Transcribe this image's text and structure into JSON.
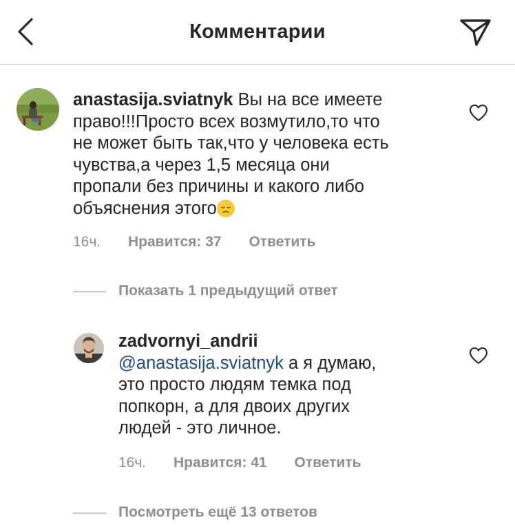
{
  "header": {
    "title": "Комментарии"
  },
  "comments": [
    {
      "username": "anastasija.sviatnyk",
      "text": " Вы на все имеете право!!!Просто всех возмутило,то что не может быть так,что у человека есть чувства,а через 1,5 месяца они пропали без причины и какого либо объяснения этого",
      "lines": [
        "Вы на все имеете",
        "право!!!Просто всех возмутило,то что",
        "не может быть так,что у человека есть",
        "чувства,а через 1,5 месяца они",
        "пропали без причины и какого либо",
        "объяснения этого"
      ],
      "emoji": "disappointed-face-emoji",
      "time": "16ч.",
      "likes": "Нравится: 37",
      "reply": "Ответить"
    },
    {
      "username": "zadvornyi_andrii",
      "mention": "@anastasija.sviatnyk",
      "lines": [
        "а я думаю,",
        "это просто людям темка под",
        "попкорн, а для двоих других",
        "людей - это личное."
      ],
      "time": "16ч.",
      "likes": "Нравится: 41",
      "reply": "Ответить"
    }
  ],
  "threads": {
    "show_previous": "Показать 1 предыдущий ответ",
    "show_more": "Посмотреть ещё 13 ответов"
  },
  "colors": {
    "text": "#262626",
    "secondary": "#8e8e8e",
    "mention": "#1d4f86",
    "divider": "#dbdbdb"
  },
  "icons": {
    "back": "chevron-left-icon",
    "share": "direct-send-icon",
    "like": "heart-outline-icon"
  }
}
